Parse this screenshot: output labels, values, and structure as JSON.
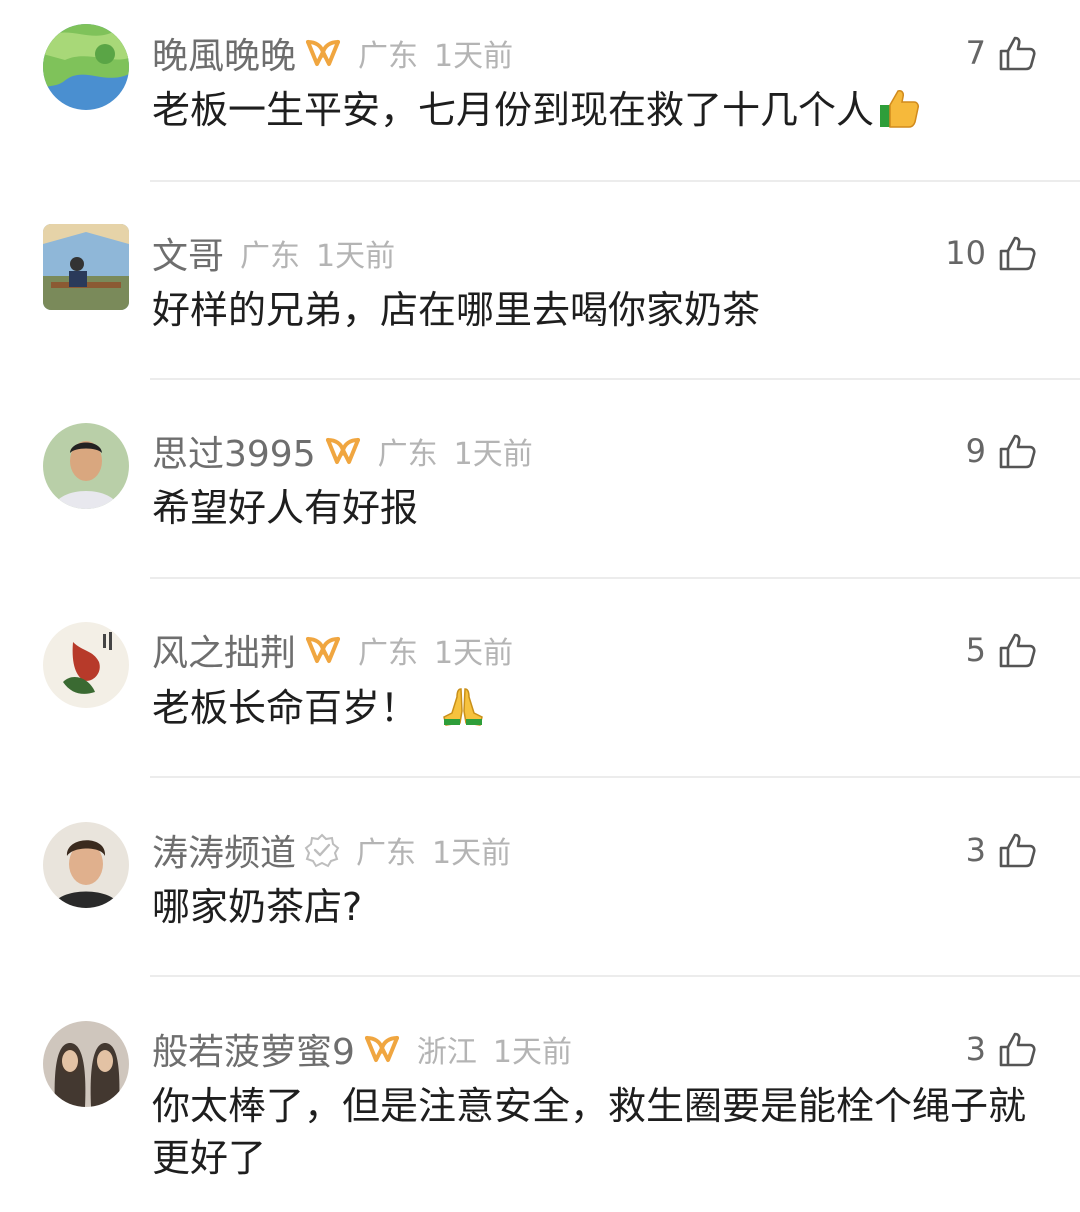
{
  "comments": [
    {
      "username": "晚風晚晚",
      "badge": "vip",
      "location": "广东",
      "time": "1天前",
      "likes": "7",
      "text": "老板一生平安，七月份到现在救了十几个人",
      "emoji": "thumbs-up-icon"
    },
    {
      "username": "文哥",
      "badge": "none",
      "location": "广东",
      "time": "1天前",
      "likes": "10",
      "text": "好样的兄弟，店在哪里去喝你家奶茶",
      "emoji": ""
    },
    {
      "username": "思过3995",
      "badge": "vip",
      "location": "广东",
      "time": "1天前",
      "likes": "9",
      "text": "希望好人有好报",
      "emoji": ""
    },
    {
      "username": "风之拙荆",
      "badge": "vip",
      "location": "广东",
      "time": "1天前",
      "likes": "5",
      "text": "老板长命百岁！",
      "emoji": "praying-hands-icon"
    },
    {
      "username": "涛涛频道",
      "badge": "verified",
      "location": "广东",
      "time": "1天前",
      "likes": "3",
      "text": "哪家奶茶店?",
      "emoji": ""
    },
    {
      "username": "般若菠萝蜜9",
      "badge": "vip",
      "location": "浙江",
      "time": "1天前",
      "likes": "3",
      "text": "你太棒了，但是注意安全，救生圈要是能栓个绳子就更好了",
      "emoji": ""
    }
  ],
  "colors": {
    "username": "#6e6e6e",
    "meta": "#b4b4b4",
    "text": "#1e1e1e",
    "vip_badge": "#f0a640",
    "divider": "#ececec"
  }
}
